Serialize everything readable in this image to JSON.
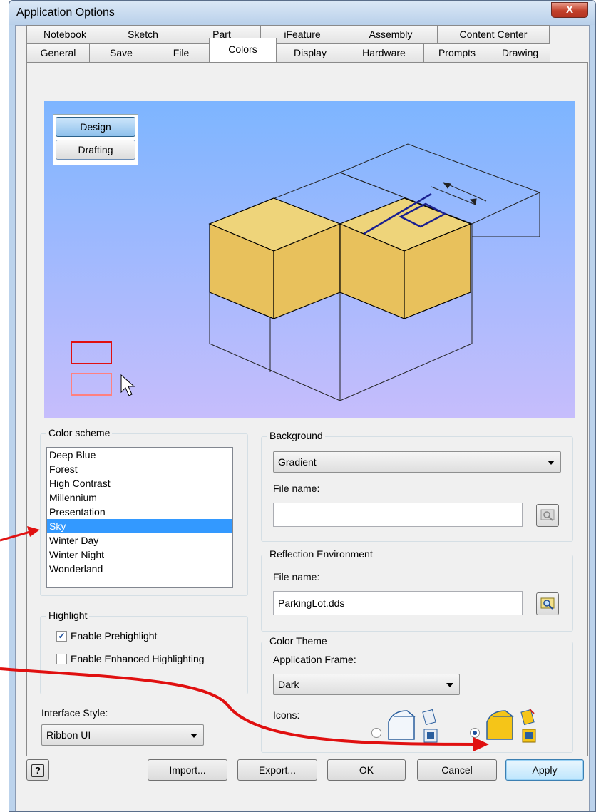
{
  "window": {
    "title": "Application Options",
    "close_label": "X"
  },
  "tabs": {
    "row1": [
      "Notebook",
      "Sketch",
      "Part",
      "iFeature",
      "Assembly",
      "Content Center"
    ],
    "row2": [
      "General",
      "Save",
      "File",
      "Colors",
      "Display",
      "Hardware",
      "Prompts",
      "Drawing"
    ],
    "active": "Colors"
  },
  "preview": {
    "design_label": "Design",
    "drafting_label": "Drafting"
  },
  "color_scheme": {
    "title": "Color scheme",
    "items": [
      "Deep Blue",
      "Forest",
      "High Contrast",
      "Millennium",
      "Presentation",
      "Sky",
      "Winter Day",
      "Winter Night",
      "Wonderland"
    ],
    "selected": "Sky"
  },
  "background": {
    "title": "Background",
    "value": "Gradient",
    "file_label": "File name:",
    "file_value": ""
  },
  "reflection": {
    "title": "Reflection Environment",
    "file_label": "File name:",
    "file_value": "ParkingLot.dds"
  },
  "highlight": {
    "title": "Highlight",
    "prehighlight_label": "Enable Prehighlight",
    "prehighlight_checked": true,
    "enhanced_label": "Enable Enhanced Highlighting",
    "enhanced_checked": false
  },
  "color_theme": {
    "title": "Color Theme",
    "frame_label": "Application Frame:",
    "frame_value": "Dark",
    "icons_label": "Icons:"
  },
  "interface": {
    "label": "Interface Style:",
    "value": "Ribbon UI"
  },
  "buttons": {
    "help": "?",
    "import": "Import...",
    "export": "Export...",
    "ok": "OK",
    "cancel": "Cancel",
    "apply": "Apply"
  },
  "colors": {
    "accent_red": "#e01010",
    "selection": "#3399ff",
    "cube_face": "#e8c15c"
  }
}
